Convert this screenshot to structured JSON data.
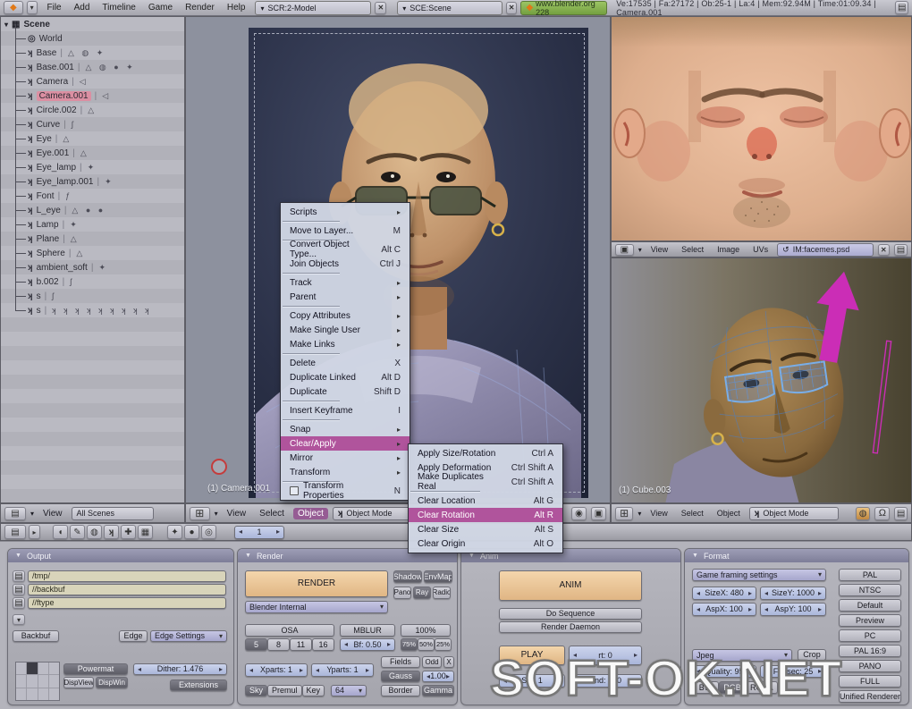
{
  "topbar": {
    "menus": [
      "File",
      "Add",
      "Timeline",
      "Game",
      "Render",
      "Help"
    ],
    "screen_field": "SCR:2-Model",
    "scene_field": "SCE:Scene",
    "version": "www.blender.org 228",
    "stats": "Ve:17535 | Fa:27172 | Ob:25-1 | La:4 | Mem:92.94M | Time:01:09.34 | Camera.001"
  },
  "outliner": {
    "root": "Scene",
    "header_menu": "View",
    "scene_selector": "All Scenes",
    "items": [
      {
        "name": "World",
        "ico": "◎",
        "icons": ""
      },
      {
        "name": "Base",
        "ico": "ʞ",
        "icons": "△ ◍ ✦"
      },
      {
        "name": "Base.001",
        "ico": "ʞ",
        "icons": "△ ◍ ● ✦"
      },
      {
        "name": "Camera",
        "ico": "ʞ",
        "icons": "◁"
      },
      {
        "name": "Camera.001",
        "ico": "ʞ",
        "icons": "◁",
        "cls": "selected"
      },
      {
        "name": "Circle.002",
        "ico": "ʞ",
        "icons": "△"
      },
      {
        "name": "Curve",
        "ico": "ʞ",
        "icons": "ʃ"
      },
      {
        "name": "Eye",
        "ico": "ʞ",
        "icons": "△"
      },
      {
        "name": "Eye.001",
        "ico": "ʞ",
        "icons": "△"
      },
      {
        "name": "Eye_lamp",
        "ico": "ʞ",
        "icons": "✦"
      },
      {
        "name": "Eye_lamp.001",
        "ico": "ʞ",
        "icons": "✦"
      },
      {
        "name": "Font",
        "ico": "ʞ",
        "icons": "ƒ"
      },
      {
        "name": "L_eye",
        "ico": "ʞ",
        "icons": "△ ● ●"
      },
      {
        "name": "Lamp",
        "ico": "ʞ",
        "icons": "✦"
      },
      {
        "name": "Plane",
        "ico": "ʞ",
        "icons": "△"
      },
      {
        "name": "Sphere",
        "ico": "ʞ",
        "icons": "△"
      },
      {
        "name": "ambient_soft",
        "ico": "ʞ",
        "icons": "✦"
      },
      {
        "name": "b.002",
        "ico": "ʞ",
        "icons": "ʃ"
      },
      {
        "name": "s",
        "ico": "ʞ",
        "icons": "ʃ"
      },
      {
        "name": "s",
        "ico": "ʞ",
        "icons": "ʞ ʞ ʞ ʞ ʞ ʞ ʞ ʞ ʞ"
      }
    ]
  },
  "context_menu": {
    "items": [
      {
        "label": "Scripts",
        "arrow": true
      },
      {
        "cls": "sep"
      },
      {
        "label": "Move to Layer...",
        "shortcut": "M"
      },
      {
        "cls": "sep"
      },
      {
        "label": "Convert Object Type...",
        "shortcut": "Alt C"
      },
      {
        "label": "Join Objects",
        "shortcut": "Ctrl J"
      },
      {
        "cls": "sep"
      },
      {
        "label": "Track",
        "arrow": true
      },
      {
        "label": "Parent",
        "arrow": true
      },
      {
        "cls": "sep"
      },
      {
        "label": "Copy Attributes",
        "arrow": true
      },
      {
        "label": "Make Single User",
        "arrow": true
      },
      {
        "label": "Make Links",
        "arrow": true
      },
      {
        "cls": "sep"
      },
      {
        "label": "Delete",
        "shortcut": "X"
      },
      {
        "label": "Duplicate Linked",
        "shortcut": "Alt D"
      },
      {
        "label": "Duplicate",
        "shortcut": "Shift D"
      },
      {
        "cls": "sep"
      },
      {
        "label": "Insert Keyframe",
        "shortcut": "I"
      },
      {
        "cls": "sep"
      },
      {
        "label": "Snap",
        "arrow": true
      },
      {
        "label": "Clear/Apply",
        "arrow": true,
        "cls": "hl"
      },
      {
        "label": "Mirror",
        "arrow": true
      },
      {
        "label": "Transform",
        "arrow": true
      },
      {
        "cls": "sep"
      },
      {
        "label": "Transform Properties",
        "shortcut": "N",
        "check": true
      }
    ]
  },
  "submenu": {
    "items": [
      {
        "label": "Apply Size/Rotation",
        "shortcut": "Ctrl A"
      },
      {
        "label": "Apply Deformation",
        "shortcut": "Ctrl Shift A"
      },
      {
        "label": "Make Duplicates Real",
        "shortcut": "Ctrl Shift A"
      },
      {
        "cls": "sep"
      },
      {
        "label": "Clear Location",
        "shortcut": "Alt G"
      },
      {
        "label": "Clear Rotation",
        "shortcut": "Alt R",
        "cls": "hl"
      },
      {
        "label": "Clear Size",
        "shortcut": "Alt S"
      },
      {
        "label": "Clear Origin",
        "shortcut": "Alt O"
      }
    ]
  },
  "vp_center": {
    "menu_view": "View",
    "menu_select": "Select",
    "menu_object": "Object",
    "mode": "Object Mode",
    "label": "(1) Camera.001"
  },
  "uv_editor": {
    "menu_view": "View",
    "menu_select": "Select",
    "menu_image": "Image",
    "menu_uvs": "UVs",
    "image_name": "IM:facemes.psd"
  },
  "vp_right": {
    "menu_view": "View",
    "menu_select": "Select",
    "menu_object": "Object",
    "mode": "Object Mode",
    "label": "(1) Cube.003"
  },
  "buttons_header": {
    "context_icons": [
      "logic",
      "script",
      "shading",
      "object",
      "editing",
      "scene"
    ],
    "sub_icons": [
      "lamp",
      "material",
      "world"
    ],
    "frame": "1"
  },
  "panels": {
    "output": {
      "title": "Output",
      "fields": [
        "/tmp/",
        "//backbuf",
        "//ftype"
      ],
      "backbuf": "Backbuf",
      "edge": "Edge",
      "edge_settings": "Edge Settings",
      "group_label": "Powermat",
      "dispview": "DispView",
      "dispwin": "DispWin",
      "dither": "Dither: 1.476",
      "extensions": "Extensions"
    },
    "render": {
      "title": "Render",
      "render_button": "RENDER",
      "engine": "Blender Internal",
      "row1": [
        {
          "label": "Shadow",
          "cls": "dk"
        },
        {
          "label": "EnvMap",
          "cls": "dk"
        }
      ],
      "row2": [
        {
          "label": "Pano"
        },
        {
          "label": "Ray",
          "cls": "dk"
        },
        {
          "label": "Radio"
        }
      ],
      "osa_label": "OSA",
      "osa": [
        {
          "label": "5",
          "cls": "dk"
        },
        {
          "label": "8"
        },
        {
          "label": "11"
        },
        {
          "label": "16"
        }
      ],
      "mblur_label": "MBLUR",
      "bf": "Bf: 0.50",
      "pct_label": "100%",
      "pcts": [
        {
          "label": "75%",
          "cls": "dk"
        },
        {
          "label": "50%"
        },
        {
          "label": "25%"
        }
      ],
      "xparts": "Xparts: 1",
      "yparts": "Yparts: 1",
      "fields_label": "Fields",
      "odd": "Odd",
      "x": "X",
      "gauss": "Gauss",
      "gauss_val": "1.00",
      "border": "Border",
      "gamma": "Gamma",
      "alpha": [
        {
          "label": "Sky",
          "cls": "dk"
        },
        {
          "label": "Premul"
        },
        {
          "label": "Key"
        }
      ],
      "octree": "64"
    },
    "anim": {
      "title": "Anim",
      "anim_button": "ANIM",
      "do_sequence": "Do Sequence",
      "render_daemon": "Render Daemon",
      "play": "PLAY",
      "rt": "rt: 0",
      "sta": "Sta: 1",
      "end": "End: 250"
    },
    "format": {
      "title": "Format",
      "framing": "Game framing settings",
      "sizex": "SizeX: 480",
      "sizey": "SizeY: 1000",
      "aspx": "AspX: 100",
      "aspy": "AspY: 100",
      "filetype": "Jpeg",
      "crop": "Crop",
      "quality": "Quality: 95",
      "frs": "Frs/sec: 25",
      "modes": [
        {
          "label": "BW"
        },
        {
          "label": "RGB",
          "cls": "dk"
        },
        {
          "label": "RGBA"
        }
      ],
      "presets": [
        {
          "label": "PAL"
        },
        {
          "label": "NTSC"
        },
        {
          "label": "Default"
        },
        {
          "label": "Preview"
        },
        {
          "label": "PC"
        },
        {
          "label": "PAL 16:9"
        },
        {
          "label": "PANO"
        },
        {
          "label": "FULL"
        },
        {
          "label": "Unified Renderer"
        }
      ]
    }
  },
  "watermark": "SOFT-OK.NET",
  "colors": {
    "accent_pink": "#b0549c",
    "selected_row": "#db8fa2",
    "version_green": "#84b050",
    "peach_button": "#ecc698",
    "stepper_blue": "#b8c2e0"
  }
}
